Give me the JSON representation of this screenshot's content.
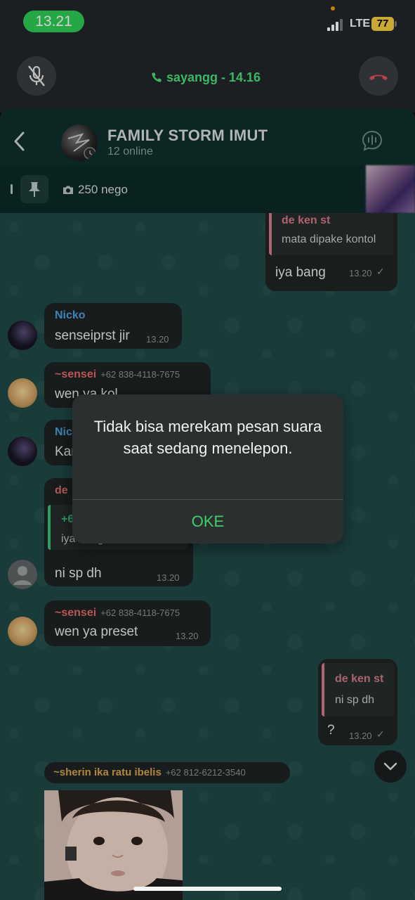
{
  "status_bar": {
    "time": "13.21",
    "network": "LTE",
    "battery": "77"
  },
  "call_bar": {
    "caller": "sayangg - 14.16"
  },
  "header": {
    "group_name": "FAMILY STORM IMUT",
    "status": "12 online"
  },
  "pinned": {
    "text": "250 nego"
  },
  "messages": {
    "m1": {
      "reply_sender": "de ken st",
      "reply_text": "mata dipake kontol",
      "text": "iya bang",
      "time": "13.20"
    },
    "m2": {
      "sender": "Nicko",
      "text": "senseiprst jir",
      "time": "13.20"
    },
    "m3": {
      "sender": "~sensei",
      "phone": "+62 838-4118-7675",
      "text": "wen ya kol"
    },
    "m4": {
      "sender": "Nic",
      "text": "Kar"
    },
    "m5": {
      "sender": "de",
      "reply_sender": "+6",
      "reply_text": "iya bang",
      "text": "ni sp dh",
      "time": "13.20"
    },
    "m6": {
      "sender": "~sensei",
      "phone": "+62 838-4118-7675",
      "text": "wen ya preset",
      "time": "13.20"
    },
    "m7": {
      "reply_sender": "de ken st",
      "reply_text": "ni sp dh",
      "text": "?",
      "time": "13.20"
    },
    "m8": {
      "sender": "~sherin ika ratu ibelis",
      "phone": "+62 812-6212-3540"
    }
  },
  "dialog": {
    "message": "Tidak bisa merekam pesan suara saat sedang menelepon.",
    "ok_label": "OKE"
  },
  "colors": {
    "accent_green": "#3fcf6d",
    "end_call_red": "#e8505b",
    "sender_nicko": "#4aa3df",
    "sender_sensei": "#e06a6a",
    "sender_sherin": "#d6a54a",
    "reply_bar_pink": "#d47a8a"
  }
}
